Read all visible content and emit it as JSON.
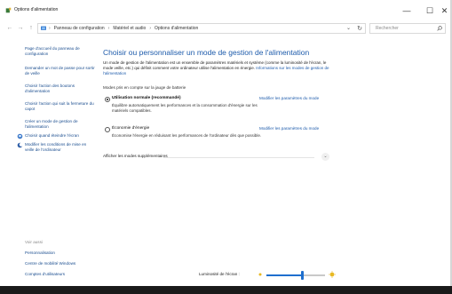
{
  "window": {
    "title": "Options d'alimentation",
    "icon": "power-options-icon",
    "min_glyph": "—",
    "max_glyph": "☐",
    "close_glyph": "✕"
  },
  "address": {
    "back_glyph": "←",
    "forward_glyph": "→",
    "up_glyph": "↑",
    "crumbs": [
      "Panneau de configuration",
      "Matériel et audio",
      "Options d'alimentation"
    ],
    "separator": "›",
    "dropdown_glyph": "⌄",
    "refresh_glyph": "↻",
    "search_placeholder": "Rechercher"
  },
  "sidebar": {
    "home_link": "Page d'accueil du panneau de configuration",
    "links": [
      {
        "label": "Demander un mot de passe pour sortir de veille",
        "icon": null
      },
      {
        "label": "Choisir l'action des boutons d'alimentation",
        "icon": null
      },
      {
        "label": "Choisir l'action qui suit la fermeture du capot",
        "icon": null
      },
      {
        "label": "Créer un mode de gestion de l'alimentation",
        "icon": null
      },
      {
        "label": "Choisir quand éteindre l'écran",
        "icon": "display-icon"
      },
      {
        "label": "Modifier les conditions de mise en veille de l'ordinateur",
        "icon": "moon-icon"
      }
    ],
    "see_also": "Voir aussi",
    "bottom_links": [
      "Personnalisation",
      "Centre de mobilité Windows",
      "Comptes d'utilisateurs"
    ]
  },
  "main": {
    "title": "Choisir ou personnaliser un mode de gestion de l'alimentation",
    "intro": "Un mode de gestion de l'alimentation est un ensemble de paramètres matériels et système (comme la luminosité de l'écran, le mode veille, etc.) qui définit comment votre ordinateur utilise l'alimentation en énergie.",
    "intro_link": "Informations sur les modes de gestion de l'alimentation",
    "plans_label": "Modes pris en compte sur la jauge de batterie",
    "plans": [
      {
        "name": "Utilisation normale (recommandé)",
        "selected": true,
        "change_link": "Modifier les paramètres du mode",
        "description": "Équilibre automatiquement les performances et la consommation d'énergie sur les matériels compatibles."
      },
      {
        "name": "Économie d'énergie",
        "selected": false,
        "change_link": "Modifier les paramètres du mode",
        "description": "Économise l'énergie en réduisant les performances de l'ordinateur dès que possible."
      }
    ],
    "more_plans": "Afficher les modes supplémentaires",
    "more_chevron": "⌄"
  },
  "brightness": {
    "label": "Luminosité de l'écran :",
    "value_fraction": 0.62,
    "accent": "#1f6fce"
  },
  "colors": {
    "link": "#1d5bab",
    "title": "#1d5bab",
    "accent": "#1f6fce"
  }
}
